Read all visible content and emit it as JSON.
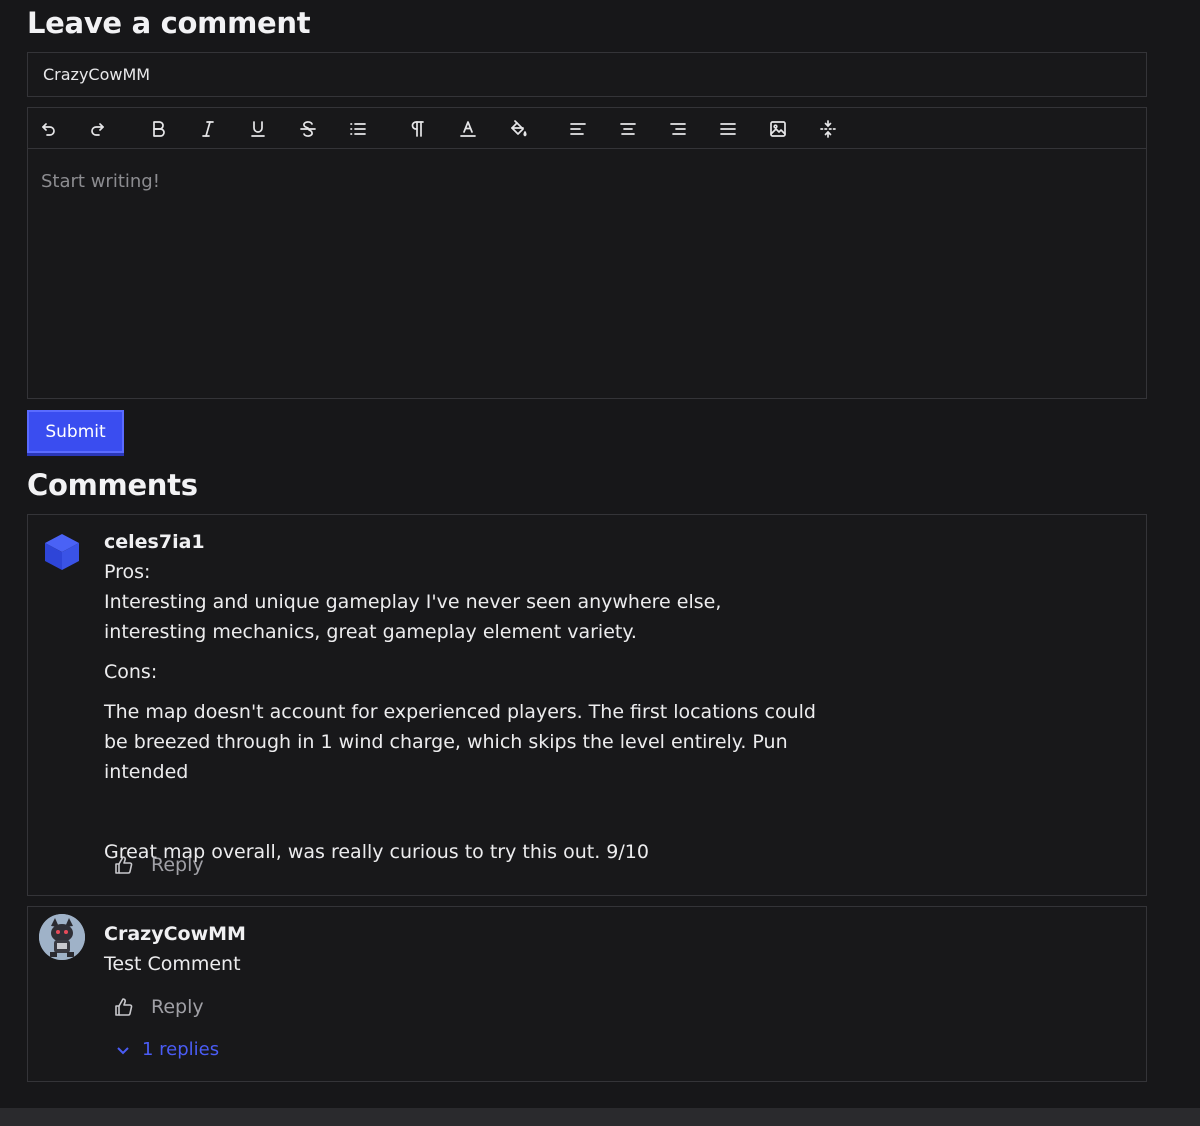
{
  "form": {
    "title": "Leave a comment",
    "name_value": "CrazyCowMM",
    "editor_placeholder": "Start writing!",
    "submit_label": "Submit",
    "toolbar": [
      {
        "name": "undo-icon"
      },
      {
        "name": "redo-icon"
      },
      {
        "name": "bold-icon"
      },
      {
        "name": "italic-icon"
      },
      {
        "name": "underline-icon"
      },
      {
        "name": "strikethrough-icon"
      },
      {
        "name": "list-icon"
      },
      {
        "name": "paragraph-icon"
      },
      {
        "name": "text-color-icon"
      },
      {
        "name": "fill-color-icon"
      },
      {
        "name": "align-left-icon"
      },
      {
        "name": "align-center-icon"
      },
      {
        "name": "align-right-icon"
      },
      {
        "name": "align-justify-icon"
      },
      {
        "name": "image-icon"
      },
      {
        "name": "compress-icon"
      }
    ]
  },
  "comments": {
    "title": "Comments",
    "items": [
      {
        "author": "celes7ia1",
        "avatar_icon": "cube-icon",
        "paragraphs": [
          "Pros:",
          "Interesting and unique gameplay I've never seen anywhere else, interesting mechanics, great gameplay element variety.",
          "Cons:",
          "The map doesn't account for experienced players. The first locations could be breezed through in 1 wind charge, which skips the level entirely. Pun intended",
          "Great map overall, was really curious to try this out. 9/10"
        ],
        "reply_label": "Reply"
      },
      {
        "author": "CrazyCowMM",
        "avatar_icon": "cat-avatar-icon",
        "paragraphs": [
          "Test Comment"
        ],
        "reply_label": "Reply",
        "replies_label": "1 replies"
      }
    ]
  },
  "colors": {
    "accent": "#3a4df0",
    "link": "#4a5cf5",
    "background": "#171719"
  }
}
